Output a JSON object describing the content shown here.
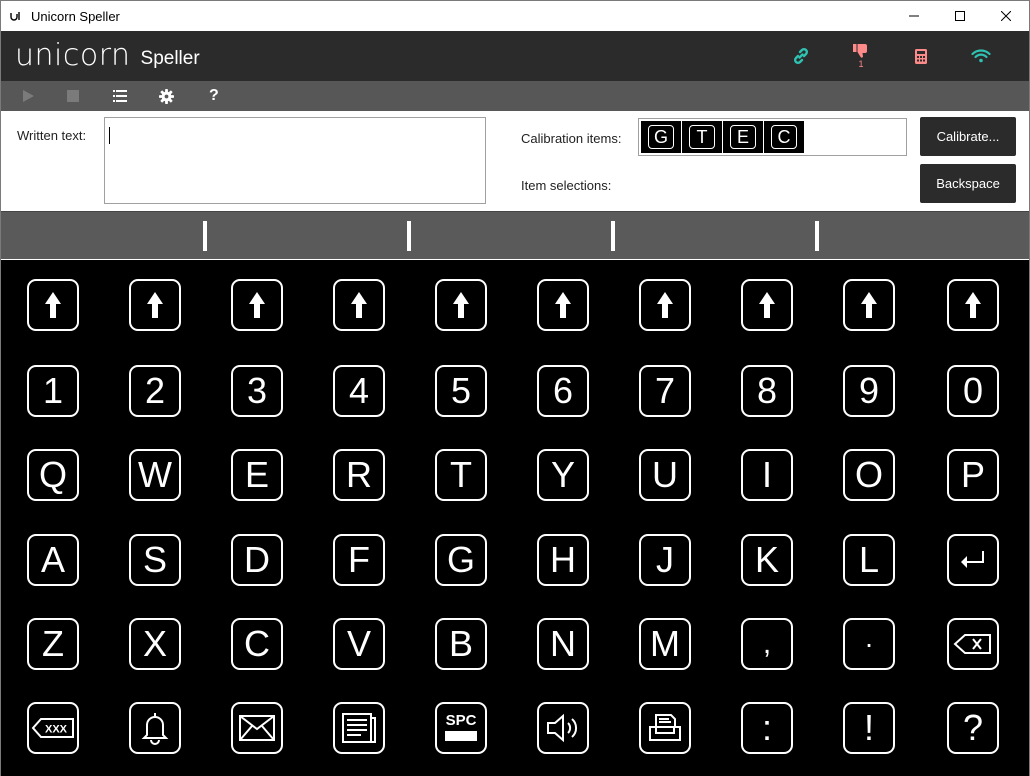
{
  "window": {
    "title": "Unicorn Speller"
  },
  "brand": {
    "logo_text": "unicorn",
    "subtitle": "Speller"
  },
  "status": {
    "link_color": "#2fc1b1",
    "pain_color": "#ff8a8a",
    "pain_badge": "1",
    "calculator_color": "#ff8a8a",
    "wifi_color": "#2fc1b1"
  },
  "toolbar": {
    "items": [
      "play-icon",
      "stop-icon",
      "list-icon",
      "gear-icon",
      "help-icon"
    ],
    "help_label": "?"
  },
  "input": {
    "written_label": "Written text:",
    "written_value": "",
    "calibration_label": "Calibration items:",
    "calibration_items": [
      "G",
      "T",
      "E",
      "C"
    ],
    "selection_label": "Item selections:",
    "calibrate_button": "Calibrate...",
    "backspace_button": "Backspace"
  },
  "keyboard": {
    "rows": [
      [
        "⬆",
        "⬆",
        "⬆",
        "⬆",
        "⬆",
        "⬆",
        "⬆",
        "⬆",
        "⬆",
        "⬆"
      ],
      [
        "1",
        "2",
        "3",
        "4",
        "5",
        "6",
        "7",
        "8",
        "9",
        "0"
      ],
      [
        "Q",
        "W",
        "E",
        "R",
        "T",
        "Y",
        "U",
        "I",
        "O",
        "P"
      ],
      [
        "A",
        "S",
        "D",
        "F",
        "G",
        "H",
        "J",
        "K",
        "L",
        "enter-icon"
      ],
      [
        "Z",
        "X",
        "C",
        "V",
        "B",
        "N",
        "M",
        ",",
        "·",
        "backspace-icon"
      ],
      [
        "delete-word-icon",
        "bell-icon",
        "mail-icon",
        "document-icon",
        "space-icon",
        "speaker-icon",
        "printer-icon",
        ":",
        "!",
        "?"
      ]
    ],
    "space_label": "SPC",
    "delete_word_label": "XXX"
  }
}
